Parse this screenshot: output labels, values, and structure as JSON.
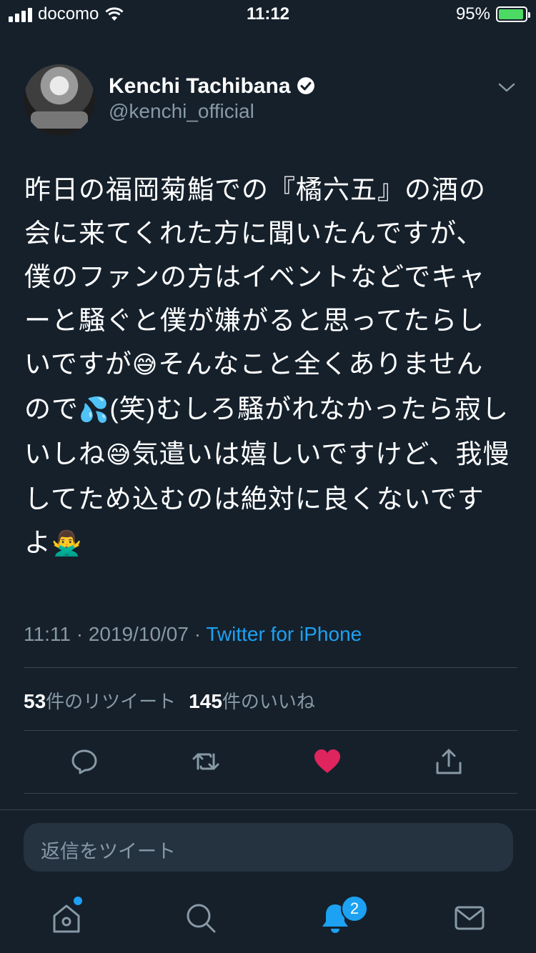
{
  "status_bar": {
    "carrier": "docomo",
    "time": "11:12",
    "battery": "95%",
    "battery_level": 0.95
  },
  "tweet": {
    "display_name": "Kenchi Tachibana",
    "handle": "@kenchi_official",
    "text_parts": [
      "昨日の福岡菊鮨での『橘六五』の酒の会に来てくれた方に聞いたんですが、僕のファンの方はイベントなどでキャーと騒ぐと僕が嫌がると思ってたらしいですが",
      "😅",
      "そんなこと全くありませんので",
      "💦",
      "(笑)むしろ騒がれなかったら寂しいしね",
      "😅",
      "気遣いは嬉しいですけど、我慢してため込むのは絶対に良くないですよ",
      "🙅‍♂️"
    ],
    "time": "11:11",
    "date": "2019/10/07",
    "separator": "·",
    "source": "Twitter for iPhone",
    "retweet_count": "53",
    "retweet_label": "件のリツイート",
    "like_count": "145",
    "like_label": "件のいいね",
    "liked": true
  },
  "reply": {
    "placeholder": "返信をツイート"
  },
  "tab_bar": {
    "notification_badge": "2"
  },
  "colors": {
    "background": "#15202b",
    "accent": "#1da1f2",
    "like": "#e0245e",
    "secondary_text": "#8899a6"
  }
}
